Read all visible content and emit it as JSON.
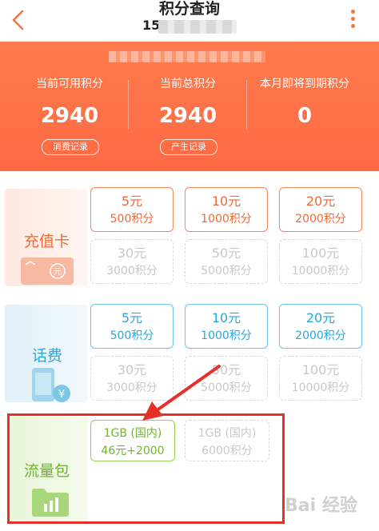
{
  "header": {
    "title": "积分查询",
    "subtitle": "15"
  },
  "summary": {
    "available": {
      "label": "当前可用积分",
      "value": "2940",
      "button": "消费记录"
    },
    "total": {
      "label": "当前总积分",
      "value": "2940",
      "button": "产生记录"
    },
    "expiring": {
      "label": "本月即将到期积分",
      "value": "0"
    }
  },
  "categories": [
    {
      "label": "充值卡",
      "icon": "card-icon",
      "theme": "#f06a36",
      "options": [
        {
          "amount": "5元",
          "points": "500积分",
          "enabled": true
        },
        {
          "amount": "10元",
          "points": "1000积分",
          "enabled": true
        },
        {
          "amount": "20元",
          "points": "2000积分",
          "enabled": true
        },
        {
          "amount": "30元",
          "points": "3000积分",
          "enabled": false
        },
        {
          "amount": "50元",
          "points": "5000积分",
          "enabled": false
        },
        {
          "amount": "100元",
          "points": "10000积分",
          "enabled": false
        }
      ]
    },
    {
      "label": "话费",
      "icon": "phone-yuan-icon",
      "theme": "#2aa7dc",
      "options": [
        {
          "amount": "5元",
          "points": "500积分",
          "enabled": true
        },
        {
          "amount": "10元",
          "points": "1000积分",
          "enabled": true
        },
        {
          "amount": "20元",
          "points": "2000积分",
          "enabled": true
        },
        {
          "amount": "30元",
          "points": "3000积分",
          "enabled": false
        },
        {
          "amount": "50元",
          "points": "5000积分",
          "enabled": false
        },
        {
          "amount": "100元",
          "points": "10000积分",
          "enabled": false
        }
      ]
    },
    {
      "label": "流量包",
      "icon": "folder-chart-icon",
      "theme": "#6fb52c",
      "options": [
        {
          "amount": "1GB (国内)",
          "points": "46元+2000",
          "enabled": true
        },
        {
          "amount": "1GB (国内)",
          "points": "6000积分",
          "enabled": false
        }
      ]
    }
  ],
  "watermark": "Bai 经验",
  "colors": {
    "banner": "#fd6a43",
    "accent": "#f07a43",
    "highlight_box": "#e8302a"
  }
}
